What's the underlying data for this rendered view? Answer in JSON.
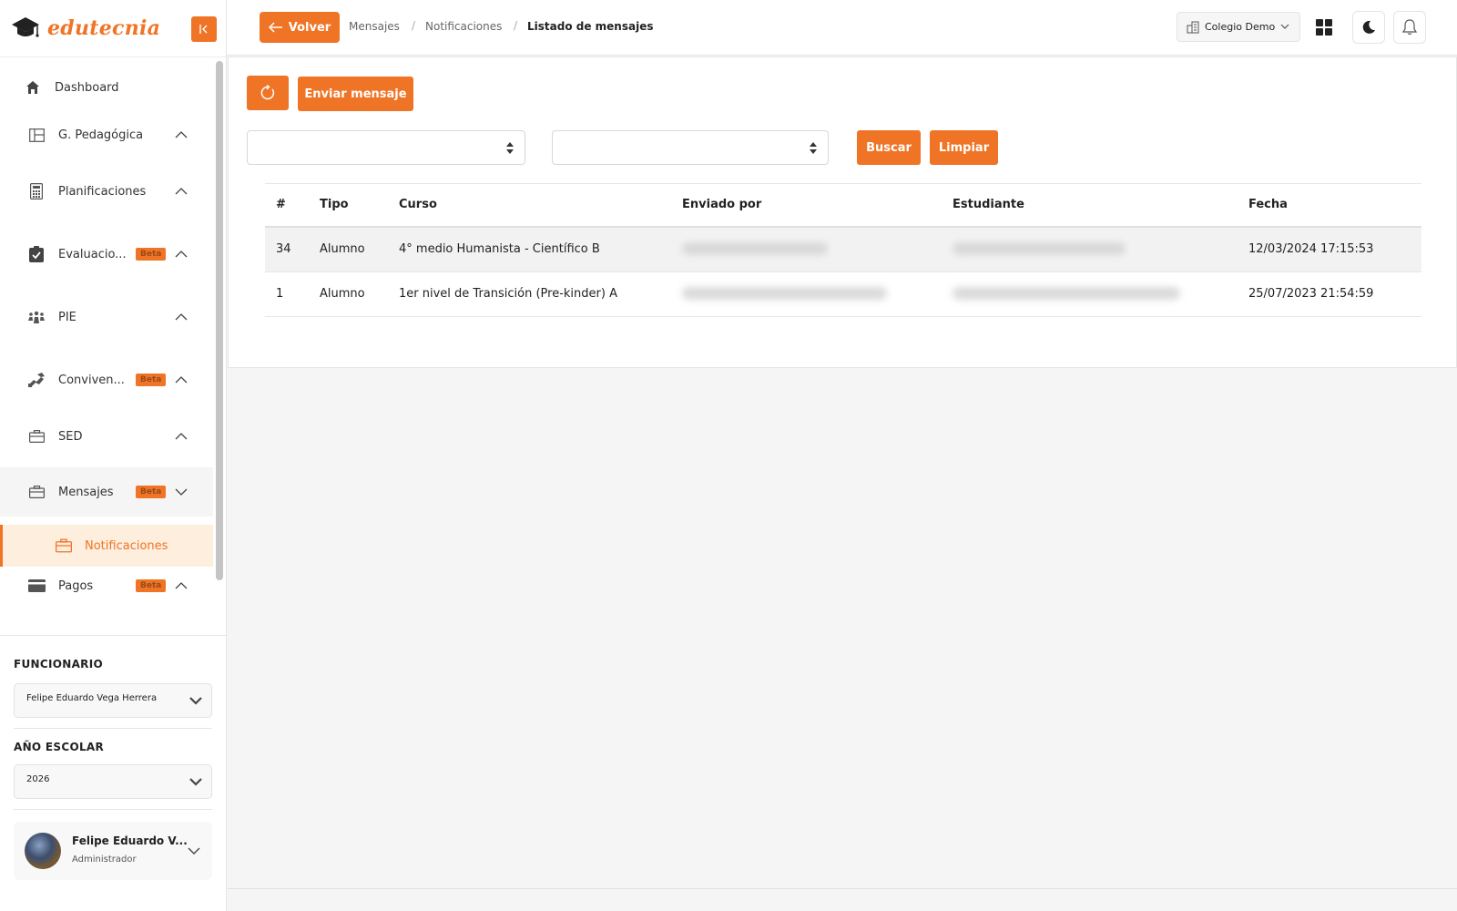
{
  "brand": {
    "name": "edutecnia"
  },
  "sidebar": {
    "items": [
      {
        "label": "Dashboard",
        "icon": "home-icon",
        "badge": "",
        "chevron": ""
      },
      {
        "label": "G. Pedagógica",
        "icon": "layout-icon",
        "badge": "",
        "chevron": "up"
      },
      {
        "label": "Planificaciones",
        "icon": "calculator-icon",
        "badge": "",
        "chevron": "up"
      },
      {
        "label": "Evaluacio...",
        "icon": "clipboard-check-icon",
        "badge": "Beta",
        "chevron": "up"
      },
      {
        "label": "PIE",
        "icon": "people-icon",
        "badge": "",
        "chevron": "up"
      },
      {
        "label": "Conviven...",
        "icon": "handshake-icon",
        "badge": "Beta",
        "chevron": "up"
      },
      {
        "label": "SED",
        "icon": "briefcase-icon",
        "badge": "",
        "chevron": "up"
      },
      {
        "label": "Mensajes",
        "icon": "briefcase-icon",
        "badge": "Beta",
        "chevron": "down"
      },
      {
        "label": "Pagos",
        "icon": "credit-card-icon",
        "badge": "Beta",
        "chevron": "up"
      }
    ],
    "active_sub": {
      "label": "Notificaciones",
      "icon": "briefcase-icon"
    },
    "funcionario_label": "FUNCIONARIO",
    "funcionario_value": "Felipe Eduardo Vega Herrera",
    "anio_label": "AÑO ESCOLAR",
    "anio_value": "2026",
    "user": {
      "name": "Felipe Eduardo V...",
      "role": "Administrador"
    }
  },
  "topbar": {
    "back_label": "Volver",
    "breadcrumb": [
      "Mensajes",
      "Notificaciones",
      "Listado de mensajes"
    ],
    "school": "Colegio Demo"
  },
  "main": {
    "send_label": "Enviar mensaje",
    "search_label": "Buscar",
    "clear_label": "Limpiar",
    "table": {
      "headers": [
        "#",
        "Tipo",
        "Curso",
        "Enviado por",
        "Estudiante",
        "Fecha"
      ],
      "rows": [
        {
          "id": "34",
          "tipo": "Alumno",
          "curso": "4° medio Humanista - Científico B",
          "fecha": "12/03/2024 17:15:53"
        },
        {
          "id": "1",
          "tipo": "Alumno",
          "curso": "1er nivel de Transición (Pre-kinder) A",
          "fecha": "25/07/2023 21:54:59"
        }
      ]
    }
  },
  "colors": {
    "accent": "#f07426",
    "active_bg": "#fdeedd"
  }
}
